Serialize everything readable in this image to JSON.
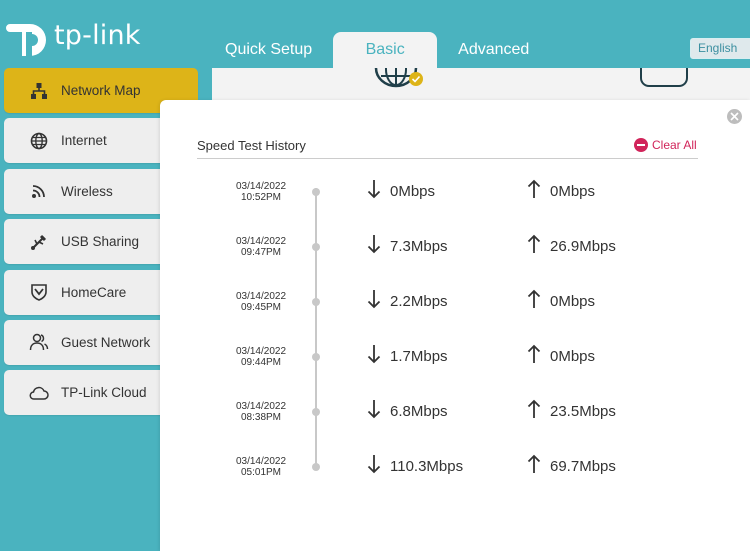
{
  "header": {
    "brand": "tp-link",
    "tabs": [
      {
        "label": "Quick Setup"
      },
      {
        "label": "Basic"
      },
      {
        "label": "Advanced"
      }
    ],
    "language": "English"
  },
  "sidebar": {
    "items": [
      {
        "label": "Network Map",
        "icon": "network-map-icon",
        "active": true
      },
      {
        "label": "Internet",
        "icon": "globe-icon"
      },
      {
        "label": "Wireless",
        "icon": "wifi-icon"
      },
      {
        "label": "USB Sharing",
        "icon": "usb-icon"
      },
      {
        "label": "HomeCare",
        "icon": "shield-icon"
      },
      {
        "label": "Guest Network",
        "icon": "guest-users-icon"
      },
      {
        "label": "TP-Link Cloud",
        "icon": "cloud-icon"
      }
    ]
  },
  "modal": {
    "title": "Speed Test History",
    "clear_all": "Clear All",
    "entries": [
      {
        "date": "03/14/2022",
        "time": "10:52PM",
        "down": "0Mbps",
        "up": "0Mbps"
      },
      {
        "date": "03/14/2022",
        "time": "09:47PM",
        "down": "7.3Mbps",
        "up": "26.9Mbps"
      },
      {
        "date": "03/14/2022",
        "time": "09:45PM",
        "down": "2.2Mbps",
        "up": "0Mbps"
      },
      {
        "date": "03/14/2022",
        "time": "09:44PM",
        "down": "1.7Mbps",
        "up": "0Mbps"
      },
      {
        "date": "03/14/2022",
        "time": "08:38PM",
        "down": "6.8Mbps",
        "up": "23.5Mbps"
      },
      {
        "date": "03/14/2022",
        "time": "05:01PM",
        "down": "110.3Mbps",
        "up": "69.7Mbps"
      }
    ]
  },
  "colors": {
    "brand_teal": "#4ab3bf",
    "active_yellow": "#ddb418",
    "clear_red": "#d1245a"
  }
}
